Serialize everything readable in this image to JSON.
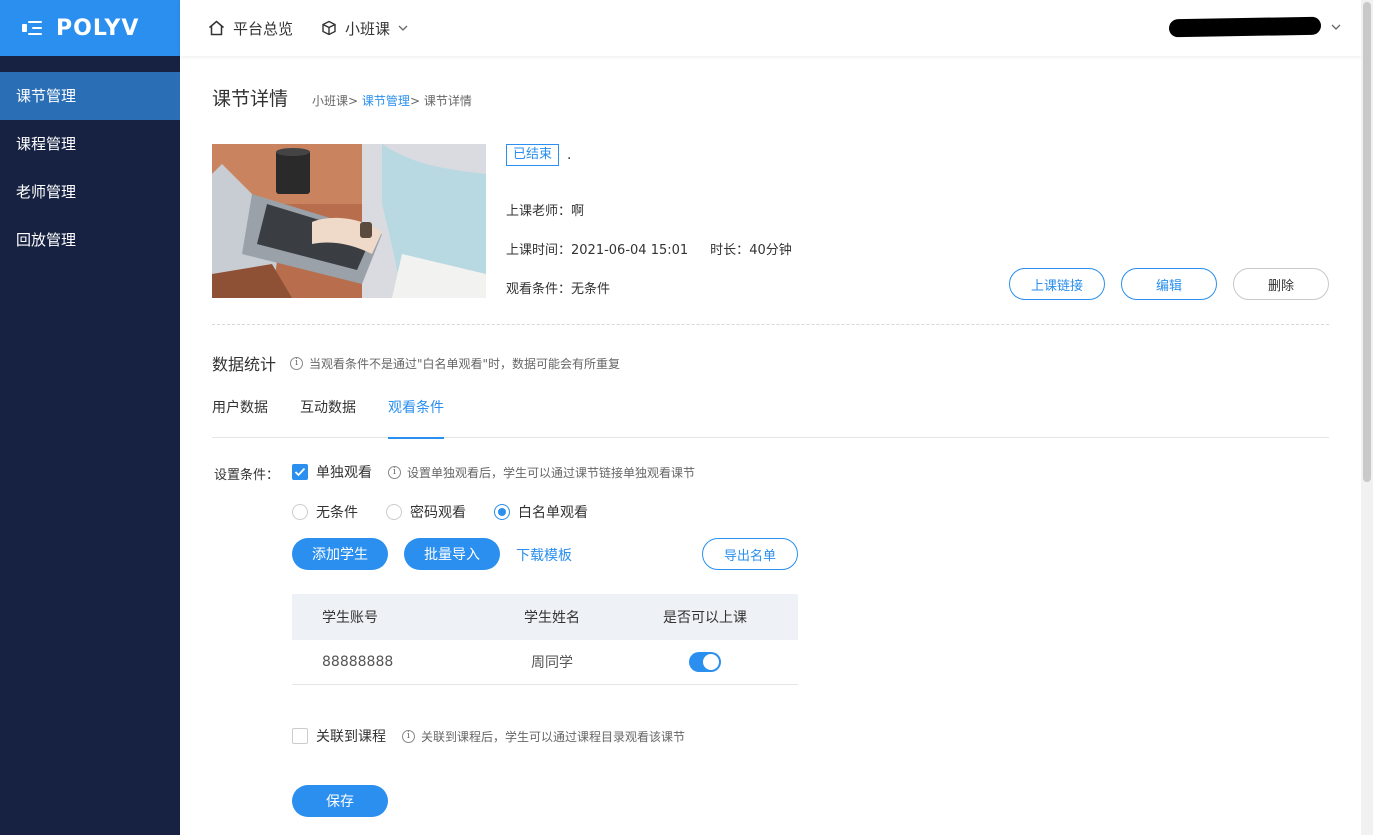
{
  "brand": {
    "logo_text": "POLYV"
  },
  "sidebar": {
    "items": [
      {
        "label": "课节管理",
        "active": true
      },
      {
        "label": "课程管理",
        "active": false
      },
      {
        "label": "老师管理",
        "active": false
      },
      {
        "label": "回放管理",
        "active": false
      }
    ]
  },
  "topbar": {
    "overview_label": "平台总览",
    "product_label": "小班课"
  },
  "page": {
    "title": "课节详情",
    "breadcrumb": [
      "小班课",
      "课节管理",
      "课节详情"
    ],
    "breadcrumb_sep": ">"
  },
  "lesson": {
    "status": "已结束",
    "name": ".",
    "teacher_label": "上课老师：",
    "teacher": "啊",
    "time_label": "上课时间：",
    "time": "2021-06-04 15:01",
    "duration_label": "时长：",
    "duration": "40分钟",
    "condition_label": "观看条件：",
    "condition": "无条件",
    "buttons": {
      "link": "上课链接",
      "edit": "编辑",
      "delete": "删除"
    }
  },
  "stats": {
    "title": "数据统计",
    "note": "当观看条件不是通过\"白名单观看\"时，数据可能会有所重复",
    "tabs": [
      {
        "label": "用户数据",
        "active": false
      },
      {
        "label": "互动数据",
        "active": false
      },
      {
        "label": "观看条件",
        "active": true
      }
    ]
  },
  "conditions": {
    "label": "设置条件：",
    "single_watch": {
      "label": "单独观看",
      "checked": true,
      "hint": "设置单独观看后，学生可以通过课节链接单独观看课节"
    },
    "options": [
      {
        "label": "无条件",
        "selected": false
      },
      {
        "label": "密码观看",
        "selected": false
      },
      {
        "label": "白名单观看",
        "selected": true
      }
    ],
    "add_student": "添加学生",
    "batch_import": "批量导入",
    "download_template": "下载模板",
    "export_list": "导出名单",
    "table": {
      "headers": [
        "学生账号",
        "学生姓名",
        "是否可以上课"
      ],
      "rows": [
        {
          "account": "88888888",
          "name": "周同学",
          "can_attend": true
        }
      ]
    },
    "link_course": {
      "label": "关联到课程",
      "checked": false,
      "hint": "关联到课程后，学生可以通过课程目录观看该课节"
    },
    "save": "保存"
  },
  "colors": {
    "primary": "#2a8fee",
    "sidebar_bg": "#172242",
    "sidebar_active": "#2a6fb6"
  }
}
